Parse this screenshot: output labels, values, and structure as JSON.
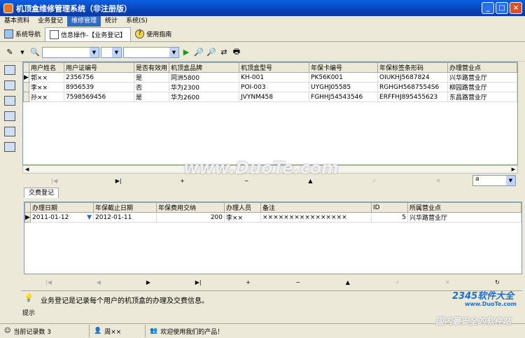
{
  "window": {
    "title": "机顶盒维修管理系统（非注册版）",
    "buttons": [
      "_",
      "□",
      "×"
    ]
  },
  "menu": [
    "基本资料",
    "业务登记",
    "维修管理",
    "统计",
    "系统(S)"
  ],
  "nav_tabs": [
    "系统导航",
    "信息操作-【业务登记】",
    "使用指南"
  ],
  "main_table": {
    "columns": [
      "用户姓名",
      "用户证编号",
      "是否有效用",
      "机顶盒品牌",
      "机顶盒型号",
      "年保卡编号",
      "年保标签条形码",
      "办理营业点"
    ],
    "rows": [
      [
        "郭××",
        "2356756",
        "是",
        "同洲5800",
        "KH-001",
        "PK56K001",
        "OIUKHJ5687824",
        "兴华路营业厅"
      ],
      [
        "李××",
        "8956539",
        "否",
        "华为2300",
        "POI-003",
        "UYGHJ05585",
        "RGHGH5687554S6",
        "柳园路营业厅"
      ],
      [
        "孙××",
        "7598569456",
        "是",
        "华为2600",
        "JVYNM458",
        "FGHHJ54543546",
        "ERFFHJ895455623",
        "东昌路营业厅"
      ]
    ]
  },
  "main_navigator": [
    "|◀",
    "▶|",
    "+",
    "−",
    "▲",
    "✓",
    "✕"
  ],
  "main_nav_select": "a",
  "detail_tab": "交费登记",
  "detail_table": {
    "columns": [
      "办理日期",
      "年保截止日期",
      "年保费用交纳",
      "办理人员",
      "备注",
      "ID",
      "所属营业点"
    ],
    "rows": [
      [
        "2011-01-12",
        "2012-01-11",
        "200",
        "李××",
        "××××××××××××××××",
        "5",
        "兴华路营业厅"
      ]
    ]
  },
  "detail_navigator": [
    "|◀",
    "◀",
    "▶",
    "▶|",
    "+",
    "−",
    "▲",
    "✓",
    "✕",
    "↻"
  ],
  "tip": {
    "text": "业务登记是记录每个用户的机顶盒的办理及交费信息。",
    "label": "提示"
  },
  "status": {
    "record_count": "当前记录数  3",
    "user": "周××",
    "welcome": "欢迎使用我们的产品！"
  },
  "watermarks": {
    "center": "www.DuoTe.com",
    "logo": "2345软件大全",
    "logo_url": "www.DuoTe.com",
    "slogan": "国内最安全的软件站"
  }
}
